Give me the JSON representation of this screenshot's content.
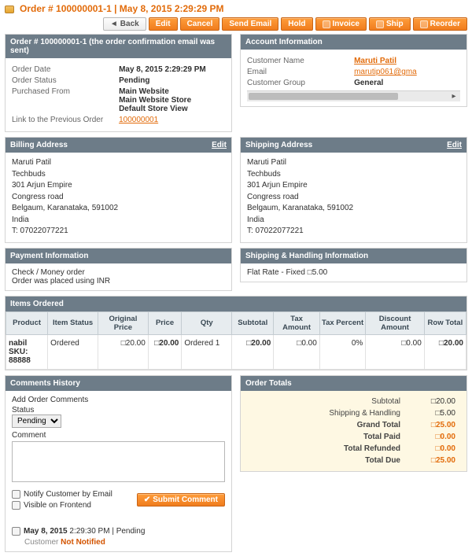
{
  "header": {
    "title": "Order # 100000001-1 | May 8, 2015 2:29:29 PM",
    "buttons": {
      "back": "Back",
      "edit": "Edit",
      "cancel": "Cancel",
      "send_email": "Send Email",
      "hold": "Hold",
      "invoice": "Invoice",
      "ship": "Ship",
      "reorder": "Reorder"
    }
  },
  "order_info": {
    "head": "Order # 100000001-1 (the order confirmation email was sent)",
    "date_label": "Order Date",
    "date_value": "May 8, 2015 2:29:29 PM",
    "status_label": "Order Status",
    "status_value": "Pending",
    "purchased_label": "Purchased From",
    "purchased_value": "Main Website\nMain Website Store\nDefault Store View",
    "prev_label": "Link to the Previous Order",
    "prev_value": "100000001"
  },
  "account": {
    "head": "Account Information",
    "name_label": "Customer Name",
    "name_value": "Maruti Patil",
    "email_label": "Email",
    "email_value": "marutip061@gma",
    "group_label": "Customer Group",
    "group_value": "General"
  },
  "billing": {
    "head": "Billing Address",
    "edit": "Edit",
    "lines": [
      "Maruti Patil",
      "Techbuds",
      "301 Arjun Empire",
      "Congress road",
      "Belgaum, Karanataka, 591002",
      "India",
      "T: 07022077221"
    ]
  },
  "shipping": {
    "head": "Shipping Address",
    "edit": "Edit",
    "lines": [
      "Maruti Patil",
      "Techbuds",
      "301 Arjun Empire",
      "Congress road",
      "Belgaum, Karanataka, 591002",
      "India",
      "T: 07022077221"
    ]
  },
  "payment": {
    "head": "Payment Information",
    "method": "Check / Money order",
    "note": "Order was placed using INR"
  },
  "ship_method": {
    "head": "Shipping & Handling Information",
    "value": "Flat Rate - Fixed □5.00"
  },
  "items": {
    "head": "Items Ordered",
    "cols": [
      "Product",
      "Item Status",
      "Original Price",
      "Price",
      "Qty",
      "Subtotal",
      "Tax Amount",
      "Tax Percent",
      "Discount Amount",
      "Row Total"
    ],
    "row": {
      "product": "nabil\nSKU: 88888",
      "status": "Ordered",
      "orig": "□20.00",
      "price": "□20.00",
      "qty": "Ordered  1",
      "subtotal": "□20.00",
      "tax_amt": "□0.00",
      "tax_pct": "0%",
      "disc": "□0.00",
      "total": "□20.00"
    }
  },
  "comments": {
    "head": "Comments History",
    "add_label": "Add Order Comments",
    "status_label": "Status",
    "status_value": "Pending",
    "comment_label": "Comment",
    "notify_email": "Notify Customer by Email",
    "visible_front": "Visible on Frontend",
    "submit": "Submit Comment",
    "history_date": "May 8, 2015",
    "history_time": "2:29:30 PM",
    "history_status": "Pending",
    "history_cust": "Customer",
    "history_flag": "Not Notified"
  },
  "totals": {
    "head": "Order Totals",
    "subtotal_l": "Subtotal",
    "subtotal_v": "□20.00",
    "ship_l": "Shipping & Handling",
    "ship_v": "□5.00",
    "grand_l": "Grand Total",
    "grand_v": "□25.00",
    "paid_l": "Total Paid",
    "paid_v": "□0.00",
    "refund_l": "Total Refunded",
    "refund_v": "□0.00",
    "due_l": "Total Due",
    "due_v": "□25.00"
  },
  "chart_data": null
}
